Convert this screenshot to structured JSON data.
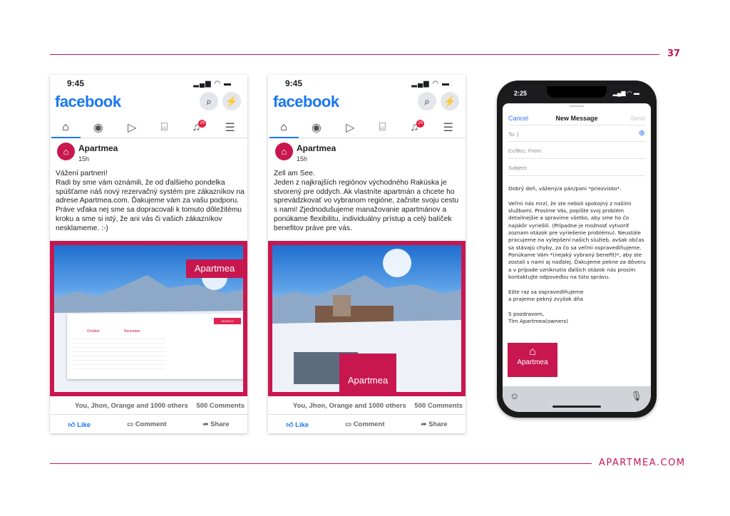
{
  "page": {
    "number": "37",
    "site": "APARTMEA.COM"
  },
  "colors": {
    "brand": "#c8174f",
    "facebook": "#1877f2"
  },
  "posts": [
    {
      "status_time": "9:45",
      "app": "facebook",
      "author": "Apartmea",
      "age": "15h",
      "text": "Vážení partneri!\nRadi by sme vám oznámili, že od ďalšieho pondelka spúšťame náš nový rezervačný systém pre zákazníkov na adrese Apartmea.com. Ďakujeme vám za vašu podporu. Práve vďaka nej sme sa dopracovali k tomuto dôležitému kroku a sme si istý, že ani vás či vašich zákazníkov nesklameme. :-)",
      "image_brand": "Apartmea",
      "calendar": {
        "month1": "October",
        "month2": "November",
        "search": "SEARCH"
      },
      "notif_count": "25",
      "reactions": "You, Jhon, Orange and 1000 others",
      "comments": "500 Comments",
      "actions": {
        "like": "Like",
        "comment": "Comment",
        "share": "Share"
      }
    },
    {
      "status_time": "9:45",
      "app": "facebook",
      "author": "Apartmea",
      "age": "15h",
      "text": "Zell am See.\nJeden z najkrajších regiónov východného Rakúska je stvorený pre oddych. Ak vlastníte apartmán a chcete ho sprevádzkovať vo vybranom regióne, začnite svoju cestu s nami! Zjednodušujeme manažovanie apartmánov a ponúkame flexibilitu, individuálny prístup a celý balíček benefitov práve pre vás.",
      "image_brand": "Apartmea",
      "notif_count": "25",
      "reactions": "You, Jhon, Orange and 1000 others",
      "comments": "500 Comments",
      "actions": {
        "like": "Like",
        "comment": "Comment",
        "share": "Share"
      }
    }
  ],
  "email": {
    "status_time": "2:25",
    "cancel": "Cancel",
    "title": "New Message",
    "send": "Send",
    "to": "To:",
    "cc": "Cc/Bcc, From:",
    "subject": "Subject:",
    "body": "Dobrý deň, vážený/a pán/pani *priezvisko*.\n\nVeľmi nás mrzí, že ste neboli spokojný z našimi službami. Prosíme Vás, popíšte svoj problém detailnejšie a spravíme všetko, aby sme ho čo najskôr vyriešili. (Prípadne je možnosť vytvoriť zoznam otázok pre vyriešenie problému). Neustále pracujeme na vylepšení našich služieb, avšak občas sa stávajú chyby, za čo sa veľmi ospravedlňujeme. Ponúkame Vám *(nejaký vybraný benefit)*, aby ste zostali s nami aj naďalej. Ďakujeme pekne za dôveru a v prípade vzniknutia ďalších otázok nás prosím kontaktujte odpoveďou na túto správu.\n\nEšte raz sa ospravedlňujeme\na prajeme pekný zvyšok dňa\n\nS pozdravom,\nTím Apartmea(owners)",
    "logo_text": "Apartmea"
  }
}
